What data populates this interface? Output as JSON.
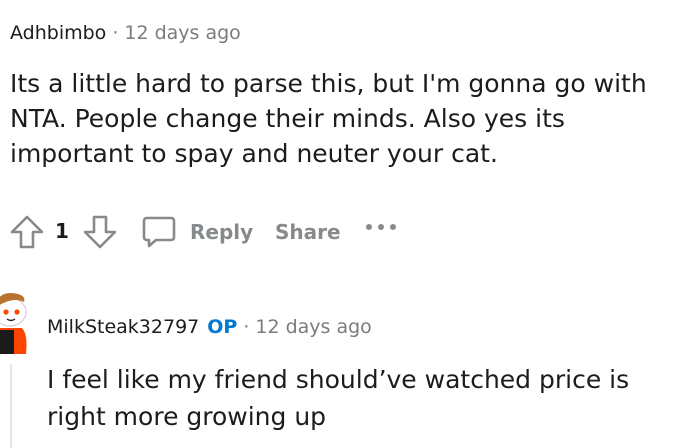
{
  "comments": [
    {
      "author": "Adhbimbo",
      "separator": "·",
      "time": "12 days ago",
      "body": "Its a little hard to parse this, but I'm gonna go with NTA. People change their minds. Also yes its important to spay and neuter your cat.",
      "score": "1",
      "reply_label": "Reply",
      "share_label": "Share"
    },
    {
      "author": "MilkSteak32797",
      "op_badge": "OP",
      "separator": "·",
      "time": "12 days ago",
      "body": "I feel like my friend should’ve watched price is right more growing up"
    }
  ],
  "colors": {
    "text": "#1c1c1c",
    "muted": "#7c7c7c",
    "action": "#878a8c",
    "op": "#0079d3"
  },
  "icons": [
    "upvote-icon",
    "downvote-icon",
    "reply-icon",
    "more-options-icon",
    "avatar"
  ]
}
